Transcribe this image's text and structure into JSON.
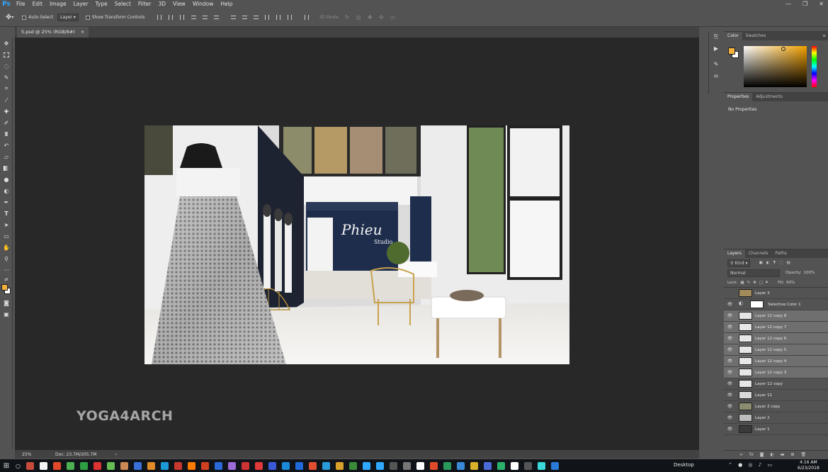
{
  "app": {
    "logo": "Ps",
    "window_controls": [
      "—",
      "❐",
      "✕"
    ]
  },
  "menu": [
    "File",
    "Edit",
    "Image",
    "Layer",
    "Type",
    "Select",
    "Filter",
    "3D",
    "View",
    "Window",
    "Help"
  ],
  "options_bar": {
    "auto_select_label": "Auto-Select",
    "auto_select_target": "Layer",
    "show_transform_label": "Show Transform Controls",
    "mode_3d_label": "3D Mode:"
  },
  "document_tab": {
    "title": "5.psd @ 25% (RGB/8#)",
    "close": "×"
  },
  "canvas": {
    "sign_text": "Phieu",
    "sign_sub": "Studio",
    "watermark_text": "YOGA4ARCH"
  },
  "status": {
    "zoom": "25%",
    "doc_size": "Doc: 23.7M/205.7M"
  },
  "color_panel": {
    "tabs": [
      "Color",
      "Swatches"
    ],
    "foreground": "#f2b23c",
    "background": "#ffffff"
  },
  "properties_panel": {
    "tabs": [
      "Properties",
      "Adjustments"
    ],
    "content": "No Properties"
  },
  "layers_panel": {
    "tabs": [
      "Layers",
      "Channels",
      "Paths"
    ],
    "filter_kind": "Kind",
    "blend_mode": "Normal",
    "opacity_label": "Opacity:",
    "opacity_value": "100%",
    "lock_label": "Lock:",
    "fill_label": "Fill:",
    "fill_value": "60%",
    "layers": [
      {
        "name": "Layer 3",
        "visible": false,
        "selected": false
      },
      {
        "name": "Selective Color 1",
        "visible": true,
        "selected": false
      },
      {
        "name": "Layer 12 copy 8",
        "visible": true,
        "selected": true
      },
      {
        "name": "Layer 12 copy 7",
        "visible": true,
        "selected": true
      },
      {
        "name": "Layer 12 copy 6",
        "visible": true,
        "selected": true
      },
      {
        "name": "Layer 12 copy 5",
        "visible": true,
        "selected": true
      },
      {
        "name": "Layer 12 copy 4",
        "visible": true,
        "selected": true
      },
      {
        "name": "Layer 12 copy 3",
        "visible": true,
        "selected": true
      },
      {
        "name": "Layer 12 copy",
        "visible": true,
        "selected": false
      },
      {
        "name": "Layer 11",
        "visible": true,
        "selected": false
      },
      {
        "name": "Layer 2 copy",
        "visible": true,
        "selected": false
      },
      {
        "name": "Layer 2",
        "visible": true,
        "selected": false
      },
      {
        "name": "Layer 1",
        "visible": true,
        "selected": false
      }
    ]
  },
  "taskbar": {
    "desktop_label": "Desktop",
    "time": "4:16 AM",
    "date": "6/23/2018"
  }
}
